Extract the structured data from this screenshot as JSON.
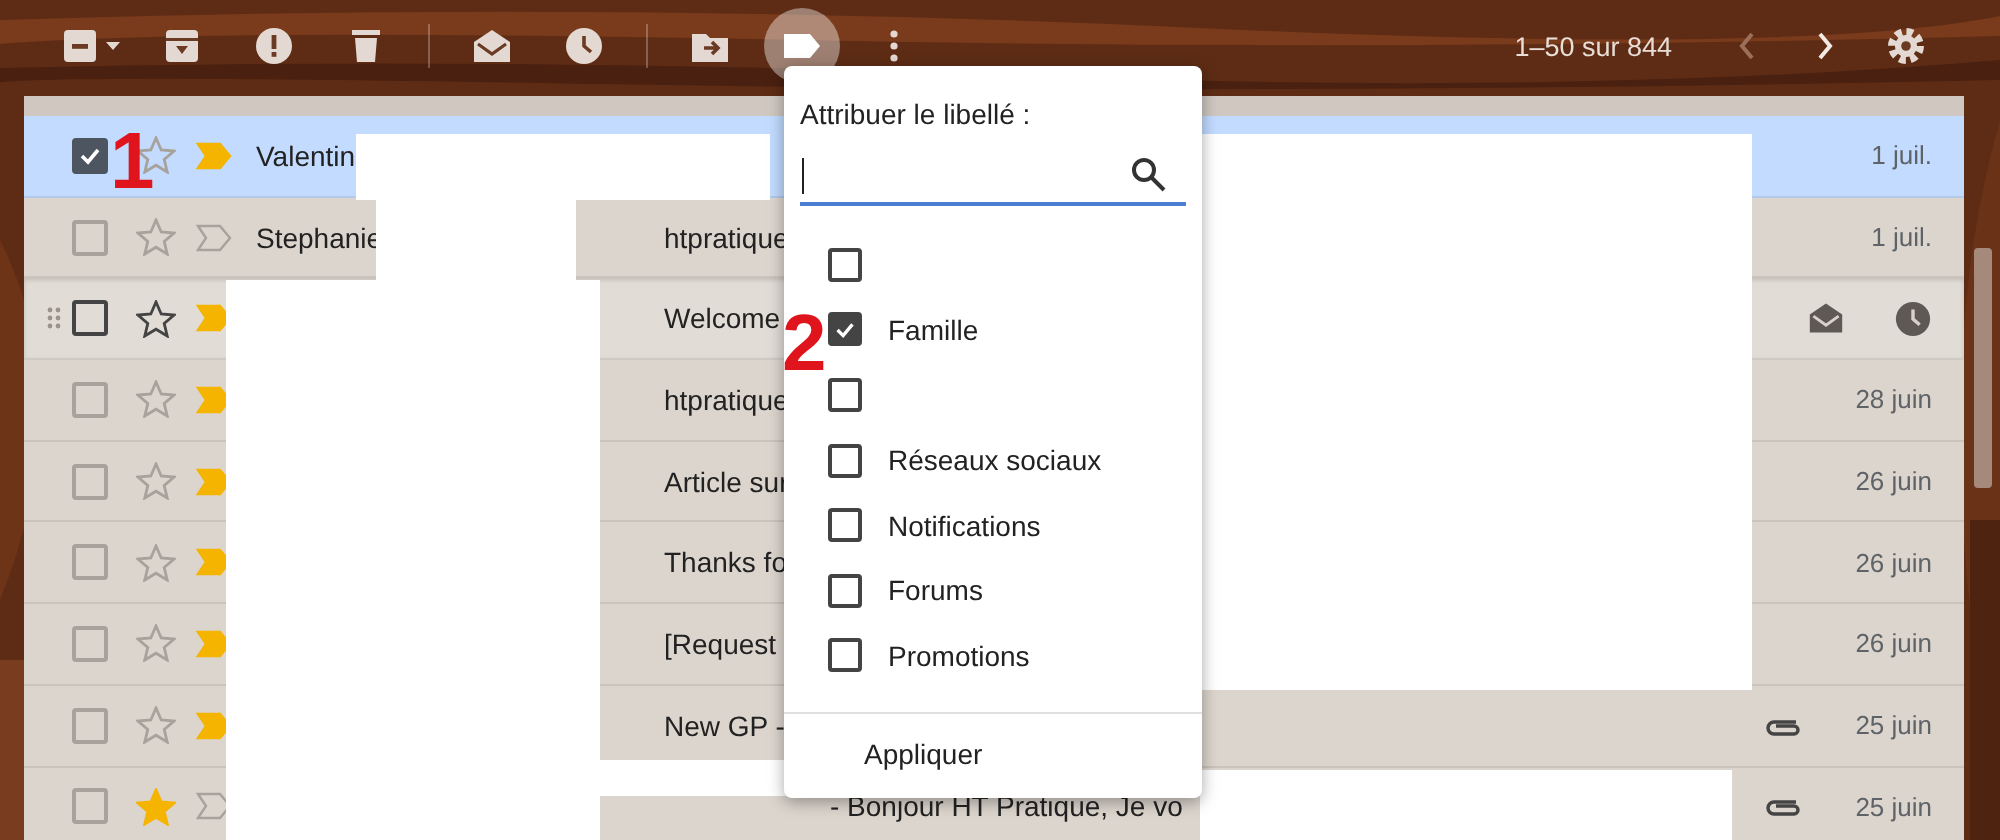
{
  "toolbar": [
    {
      "kind": "select",
      "active": false
    },
    {
      "kind": "archive",
      "active": false
    },
    {
      "kind": "spam",
      "active": false
    },
    {
      "kind": "delete",
      "active": false
    },
    {
      "kind": "divider"
    },
    {
      "kind": "mark-read",
      "active": false
    },
    {
      "kind": "snooze",
      "active": false
    },
    {
      "kind": "divider"
    },
    {
      "kind": "move",
      "active": false
    },
    {
      "kind": "label",
      "active": true
    },
    {
      "kind": "more",
      "active": false
    }
  ],
  "pagination": {
    "range": "1–50 sur 844",
    "prev_disabled": true,
    "next_disabled": false
  },
  "emails": [
    {
      "sender": "Valentin",
      "date": "1 juil.",
      "checked": true,
      "selected": true,
      "starred": false,
      "important": true,
      "attachment": false,
      "hovered": false
    },
    {
      "sender": "Stephanie",
      "subject": "htpratique",
      "date": "1 juil.",
      "checked": false,
      "selected": false,
      "starred": false,
      "important": false,
      "attachment": false,
      "hovered": false
    },
    {
      "subject": "Welcome",
      "checked": false,
      "selected": false,
      "starred": false,
      "important": true,
      "attachment": false,
      "hovered": true
    },
    {
      "subject": "htpratique",
      "date": "28 juin",
      "checked": false,
      "selected": false,
      "starred": false,
      "important": true,
      "attachment": false,
      "hovered": false
    },
    {
      "subject": "Article sur",
      "date": "26 juin",
      "checked": false,
      "selected": false,
      "starred": false,
      "important": true,
      "attachment": false,
      "hovered": false
    },
    {
      "subject": "Thanks fo",
      "date": "26 juin",
      "checked": false,
      "selected": false,
      "starred": false,
      "important": true,
      "attachment": false,
      "hovered": false
    },
    {
      "subject": "[Request",
      "date": "26 juin",
      "checked": false,
      "selected": false,
      "starred": false,
      "important": true,
      "attachment": false,
      "hovered": false
    },
    {
      "subject": "New GP -",
      "date": "25 juin",
      "checked": false,
      "selected": false,
      "starred": false,
      "important": true,
      "attachment": true,
      "hovered": false
    },
    {
      "subject": "- Bonjour HT Pratique, Je vo",
      "date": "25 juin",
      "checked": false,
      "selected": false,
      "starred": true,
      "important": false,
      "attachment": true,
      "hovered": false
    }
  ],
  "label_menu": {
    "title": "Attribuer le libellé :",
    "search_focused": true,
    "labels": [
      {
        "checked": false
      },
      {
        "label": "Famille",
        "checked": true
      },
      {
        "checked": false
      },
      {
        "label": "Réseaux sociaux",
        "checked": false
      },
      {
        "label": "Notifications",
        "checked": false
      },
      {
        "label": "Forums",
        "checked": false
      },
      {
        "label": "Promotions",
        "checked": false
      }
    ],
    "apply": "Appliquer"
  },
  "annotations": [
    {
      "text": "1"
    },
    {
      "text": "2"
    }
  ]
}
